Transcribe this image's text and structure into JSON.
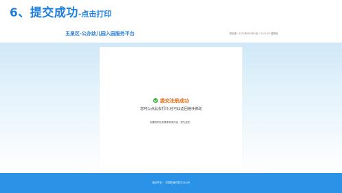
{
  "slide": {
    "title": "6、提交成功",
    "subtitle": "-点击打印"
  },
  "header": {
    "site_name": "玉泉区-公办幼儿园入园服务平台",
    "date_text": "现在是: 2022年05月30日 15:53:20 星期日"
  },
  "result": {
    "status": "提交注册成功",
    "hint": "您可以点此去打印,也可以返回继续修改",
    "note": "如果您的信息需要修改的话，请先注意。"
  },
  "footer": {
    "text": "版权所有 ：中国联通内蒙古分公司"
  },
  "colors": {
    "title_blue": "#1b7fe0",
    "success_orange": "#e66a10",
    "check_green": "#3cb43c",
    "footer_blue": "#2a93e8"
  },
  "icons": {
    "success": "check-circle-icon"
  }
}
